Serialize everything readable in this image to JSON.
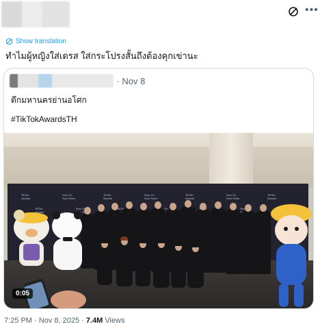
{
  "author": {
    "name_redacted": true
  },
  "post": {
    "translate_label": "Show translation",
    "text": "ทำไมผู้หญิงใส่เดรส ใส่กระโปรงสั้นถึงต้องคุกเข่านะ"
  },
  "quote": {
    "separator": "·",
    "date": "Nov 8",
    "line1": "ตึกมหานครย่านอโศก",
    "hashtag": "#TikTokAwardsTH",
    "video_duration": "0:05"
  },
  "meta": {
    "time": "7:25 PM",
    "dot1": "·",
    "date": "Nov 8, 2025",
    "dot2": "·",
    "views_count": "7.4M",
    "views_label": "Views"
  },
  "icons": {
    "grok": "grok-icon",
    "more": "more-icon",
    "translate": "translate-icon"
  },
  "colors": {
    "link": "#1d9bf0",
    "muted": "#536471",
    "text": "#0f1419",
    "border": "#cfd9de"
  }
}
